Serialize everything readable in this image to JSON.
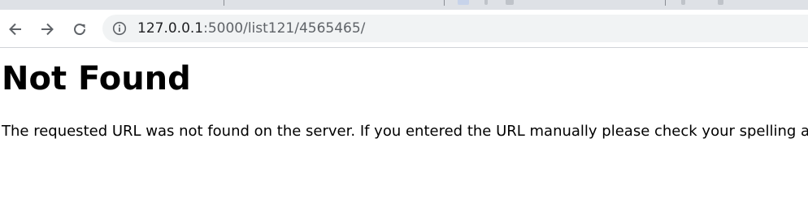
{
  "browser": {
    "address_bar": {
      "url_host": "127.0.0.1",
      "url_rest": ":5000/list121/4565465/"
    },
    "icons": {
      "back": "back-arrow-icon",
      "forward": "forward-arrow-icon",
      "reload": "reload-icon",
      "site_info": "info-icon"
    }
  },
  "page": {
    "heading": "Not Found",
    "message": "The requested URL was not found on the server. If you entered the URL manually please check your spelling and try again."
  },
  "colors": {
    "tabstrip_bg": "#dee1e6",
    "omnibox_bg": "#f1f3f4",
    "icon_color": "#5f6368",
    "text": "#000000"
  }
}
